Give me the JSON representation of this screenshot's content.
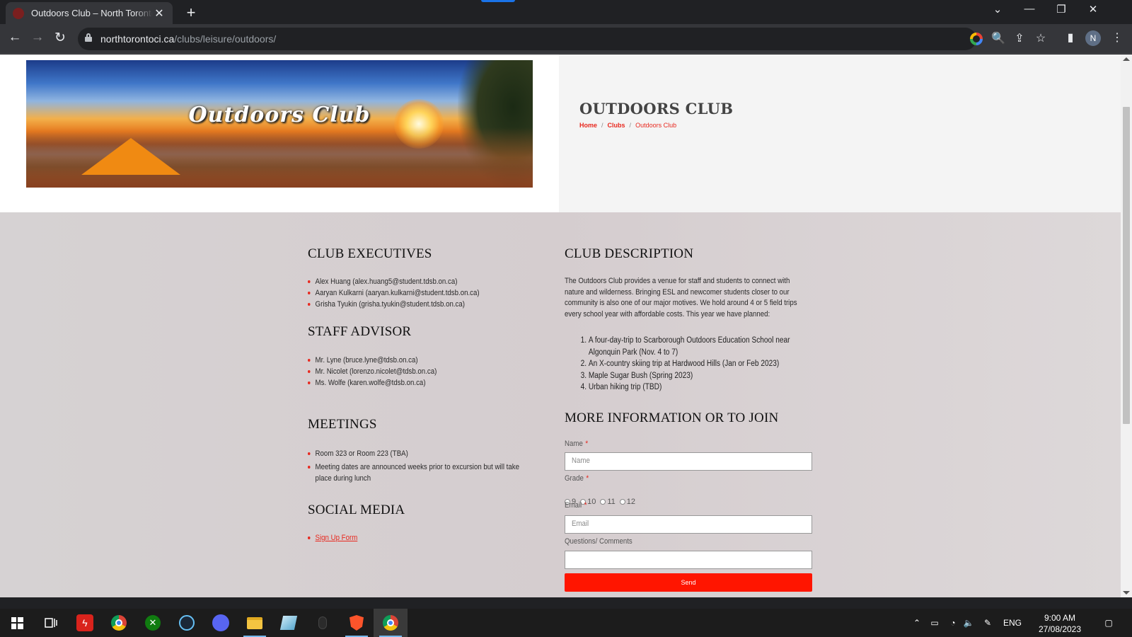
{
  "browser": {
    "tab_title": "Outdoors Club – North Toronto C",
    "tab_close": "✕",
    "new_tab": "+",
    "url_host": "northtorontoci.ca",
    "url_path": "/clubs/leisure/outdoors/",
    "profile_initial": "N",
    "window_controls": {
      "chevron": "⌄",
      "minimize": "—",
      "restore": "❐",
      "close": "✕"
    },
    "nav": {
      "back": "←",
      "forward": "→",
      "reload": "↻"
    },
    "toolbar_icons": {
      "zoom": "🔍",
      "share": "⇪",
      "bookmark": "☆",
      "side_panel": "▮",
      "menu": "⋮"
    }
  },
  "hero": {
    "banner_text": "Outdoors Club",
    "title": "OUTDOORS CLUB",
    "breadcrumb": [
      {
        "label": "Home"
      },
      {
        "label": "Clubs"
      },
      {
        "label": "Outdoors Club"
      }
    ],
    "breadcrumb_sep": "/"
  },
  "executives": {
    "heading": "CLUB EXECUTIVES",
    "items": [
      "Alex Huang (alex.huang5@student.tdsb.on.ca)",
      "Aaryan Kulkarni (aaryan.kulkarni@student.tdsb.on.ca)",
      "Grisha Tyukin (grisha.tyukin@student.tdsb.on.ca)"
    ]
  },
  "advisor": {
    "heading": "STAFF ADVISOR",
    "items": [
      "Mr. Lyne (bruce.lyne@tdsb.on.ca)",
      "Mr. Nicolet (lorenzo.nicolet@tdsb.on.ca)",
      "Ms. Wolfe (karen.wolfe@tdsb.on.ca)"
    ]
  },
  "meetings": {
    "heading": "MEETINGS",
    "items": [
      "Room 323 or Room 223 (TBA)",
      "Meeting dates are announced weeks prior to excursion but will take place during lunch"
    ]
  },
  "social": {
    "heading": "SOCIAL MEDIA",
    "link": "Sign Up Form"
  },
  "description": {
    "heading": "CLUB DESCRIPTION",
    "text": "The Outdoors Club provides a venue for staff and students to connect with nature and wilderness. Bringing ESL and newcomer students closer to our community is also one of our major motives. We hold around 4 or 5 field trips every school year with affordable costs. This year we have planned:",
    "plans": [
      "A four-day-trip to Scarborough Outdoors Education School near Algonquin Park (Nov. 4 to 7)",
      "An X-country skiing trip at Hardwood Hills (Jan or Feb 2023)",
      "Maple Sugar Bush (Spring 2023)",
      "Urban hiking trip (TBD)"
    ]
  },
  "form": {
    "heading": "MORE INFORMATION OR TO JOIN",
    "required_mark": "*",
    "name_label": "Name",
    "name_placeholder": "Name",
    "grade_label": "Grade",
    "grades": [
      "9",
      "10",
      "11",
      "12"
    ],
    "email_label": "Email",
    "email_placeholder": "Email",
    "comments_label": "Questions/ Comments",
    "send_label": "Send"
  },
  "taskbar": {
    "language": "ENG",
    "time": "9:00 AM",
    "date": "27/08/2023"
  }
}
